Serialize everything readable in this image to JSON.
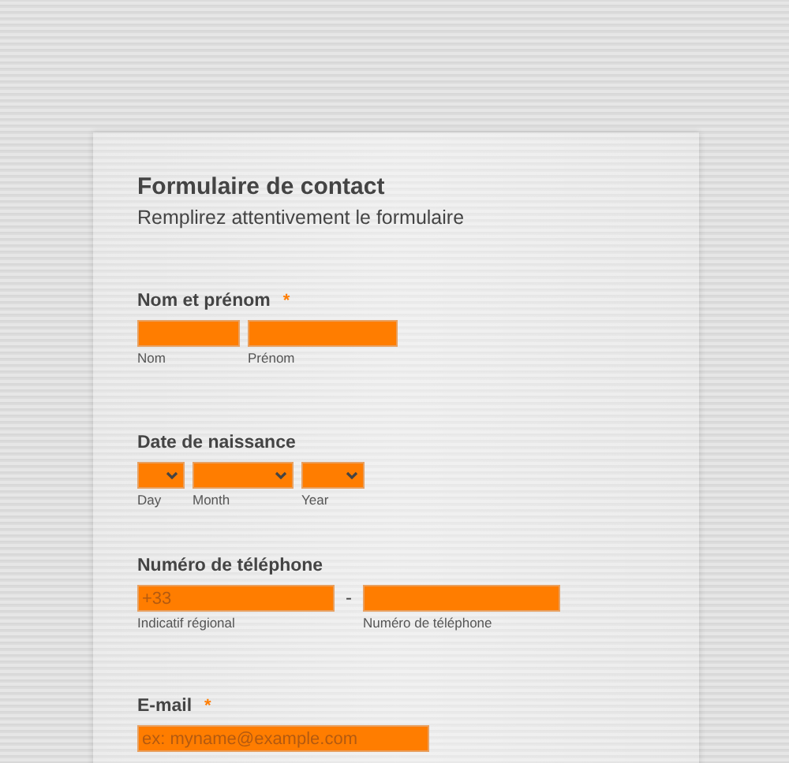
{
  "form": {
    "title": "Formulaire de contact",
    "subtitle": "Remplirez attentivement le formulaire",
    "fields": [
      {
        "kind": "text",
        "label": "Nom et prénom",
        "required_mark": "*",
        "inputs": [
          {
            "sublabel": "Nom"
          },
          {
            "sublabel": "Prénom"
          }
        ]
      },
      {
        "kind": "select",
        "label": "Date de naissance",
        "inputs": [
          {
            "sublabel": "Day"
          },
          {
            "sublabel": "Month"
          },
          {
            "sublabel": "Year"
          }
        ]
      },
      {
        "kind": "phone",
        "label": "Numéro de téléphone",
        "separator": "-",
        "inputs": [
          {
            "sublabel": "Indicatif régional",
            "placeholder": "+33"
          },
          {
            "sublabel": "Numéro de téléphone"
          }
        ]
      },
      {
        "kind": "text",
        "label": "E-mail",
        "required_mark": "*",
        "inputs": [
          {
            "placeholder": "ex: myname@example.com"
          }
        ]
      }
    ]
  }
}
